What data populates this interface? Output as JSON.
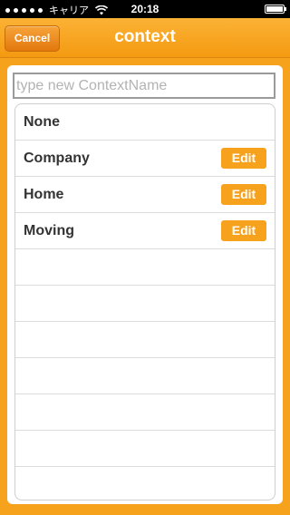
{
  "status_bar": {
    "carrier": "キャリア",
    "time": "20:18"
  },
  "nav": {
    "cancel_label": "Cancel",
    "title": "context"
  },
  "input": {
    "placeholder": "type new ContextName",
    "value": ""
  },
  "contexts": [
    {
      "label": "None",
      "edit_label": ""
    },
    {
      "label": "Company",
      "edit_label": "Edit"
    },
    {
      "label": "Home",
      "edit_label": "Edit"
    },
    {
      "label": "Moving",
      "edit_label": "Edit"
    }
  ],
  "colors": {
    "accent": "#f7a21d",
    "nav_top": "#fbb235",
    "nav_bottom": "#f49a11",
    "cancel_button": "#e2780e"
  },
  "icons": [
    "signal-icon",
    "wifi-icon",
    "battery-icon"
  ]
}
